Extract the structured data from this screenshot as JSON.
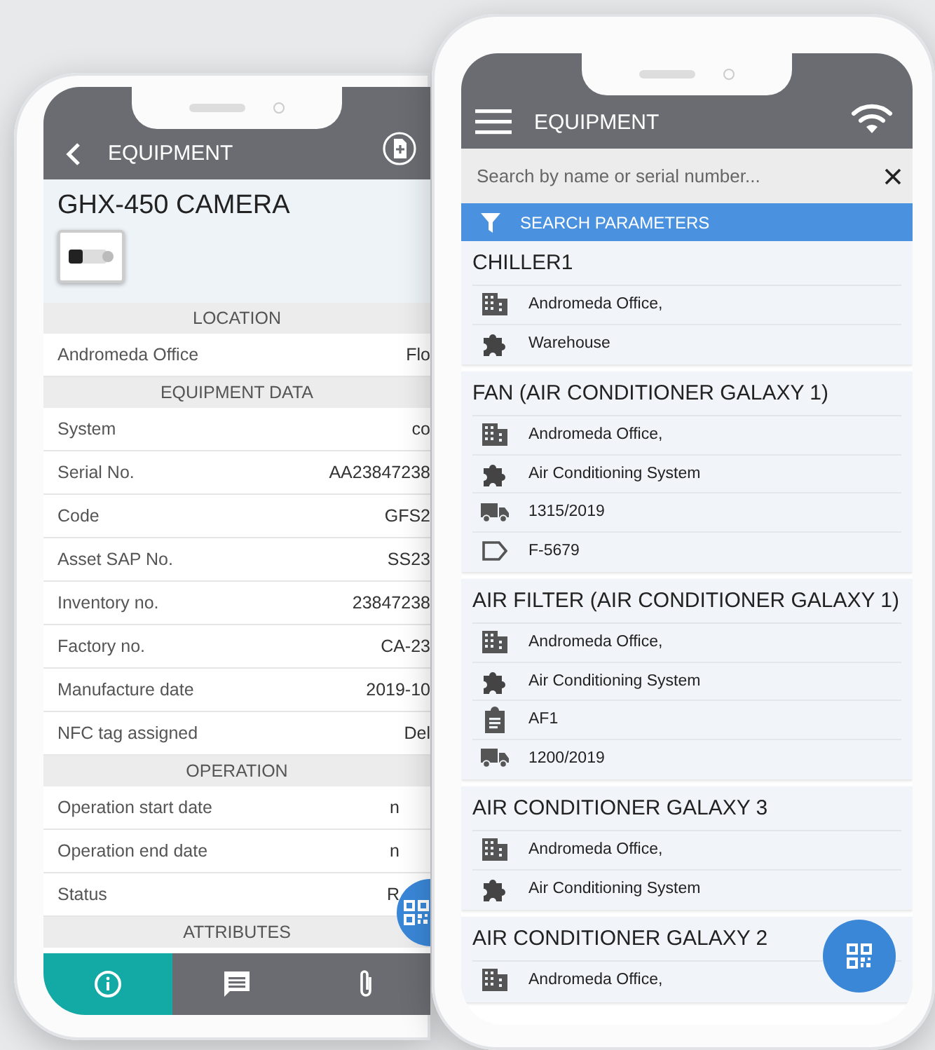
{
  "detail_phone": {
    "header": {
      "title": "EQUIPMENT"
    },
    "equipment_name": "GHX-450 CAMERA",
    "sections": [
      {
        "title": "LOCATION",
        "rows": [
          {
            "label": "Andromeda Office",
            "value": "Flo"
          }
        ]
      },
      {
        "title": "EQUIPMENT DATA",
        "rows": [
          {
            "label": "System",
            "value": "co"
          },
          {
            "label": "Serial No.",
            "value": "AA23847238"
          },
          {
            "label": "Code",
            "value": "GFS2"
          },
          {
            "label": "Asset SAP No.",
            "value": "SS23"
          },
          {
            "label": "Inventory no.",
            "value": "23847238"
          },
          {
            "label": "Factory no.",
            "value": "CA-23"
          },
          {
            "label": "Manufacture date",
            "value": "2019-10"
          },
          {
            "label": "NFC tag assigned",
            "value": "Del"
          }
        ]
      },
      {
        "title": "OPERATION",
        "rows": [
          {
            "label": "Operation start date",
            "value": "n"
          },
          {
            "label": "Operation end date",
            "value": "n"
          },
          {
            "label": "Status",
            "value": "R"
          }
        ]
      },
      {
        "title": "ATTRIBUTES"
      }
    ],
    "tabs": [
      {
        "kind": "info",
        "selected": true
      },
      {
        "kind": "comments",
        "selected": false
      },
      {
        "kind": "attachments",
        "selected": false
      }
    ]
  },
  "list_phone": {
    "header": {
      "title": "EQUIPMENT"
    },
    "search": {
      "placeholder": "Search by name or serial number..."
    },
    "filter_bar": {
      "label": "SEARCH PARAMETERS"
    },
    "items": [
      {
        "title": "CHILLER1",
        "details": [
          {
            "kind": "location",
            "text": "Andromeda Office,"
          },
          {
            "kind": "category",
            "text": "Warehouse"
          }
        ]
      },
      {
        "title": "FAN (AIR CONDITIONER GALAXY 1)",
        "details": [
          {
            "kind": "location",
            "text": "Andromeda Office,"
          },
          {
            "kind": "category",
            "text": "Air Conditioning System"
          },
          {
            "kind": "delivery",
            "text": "1315/2019"
          },
          {
            "kind": "tag",
            "text": "F-5679"
          }
        ]
      },
      {
        "title": "AIR FILTER (AIR CONDITIONER GALAXY 1)",
        "details": [
          {
            "kind": "location",
            "text": "Andromeda Office,"
          },
          {
            "kind": "category",
            "text": "Air Conditioning System"
          },
          {
            "kind": "code",
            "text": "AF1"
          },
          {
            "kind": "delivery",
            "text": "1200/2019"
          }
        ]
      },
      {
        "title": "AIR CONDITIONER GALAXY 3",
        "details": [
          {
            "kind": "location",
            "text": "Andromeda Office,"
          },
          {
            "kind": "category",
            "text": "Air Conditioning System"
          }
        ]
      },
      {
        "title": "AIR CONDITIONER GALAXY 2",
        "details": [
          {
            "kind": "location",
            "text": "Andromeda Office,"
          }
        ]
      }
    ]
  }
}
